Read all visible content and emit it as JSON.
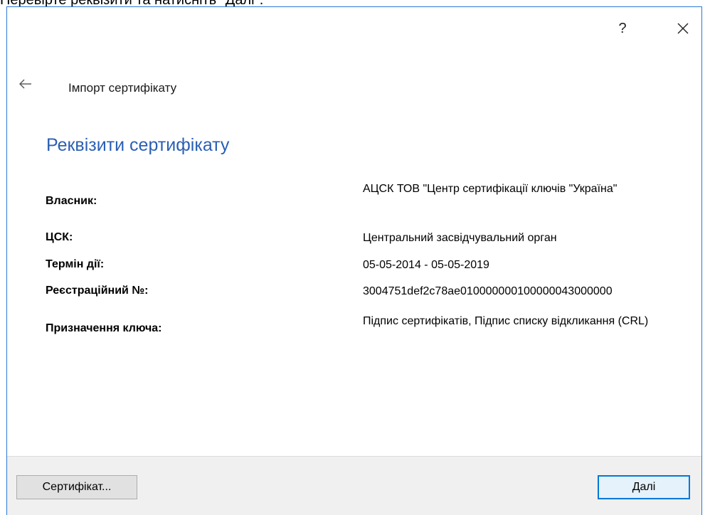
{
  "doc_caption": "Перевірте реквізити та натисніть \"Далі\".",
  "title_bar": {
    "help_label": "?"
  },
  "wizard": {
    "title": "Імпорт сертифікату"
  },
  "details": {
    "heading": "Реквізити сертифікату",
    "rows": [
      {
        "label": "Власник:",
        "value": "АЦСК ТОВ \"Центр сертифікації ключів \"Україна\""
      },
      {
        "label": "ЦСК:",
        "value": "Центральний засвідчувальний орган"
      },
      {
        "label": "Термін дії:",
        "value": "05-05-2014 - 05-05-2019"
      },
      {
        "label": "Реєстраційний №:",
        "value": "3004751def2c78ae010000000100000043000000"
      },
      {
        "label": "Призначення ключа:",
        "value": "Підпис сертифікатів, Підпис списку відкликання (CRL)"
      }
    ]
  },
  "footer": {
    "certificate_button": "Сертифікат...",
    "next_button": "Далі"
  }
}
